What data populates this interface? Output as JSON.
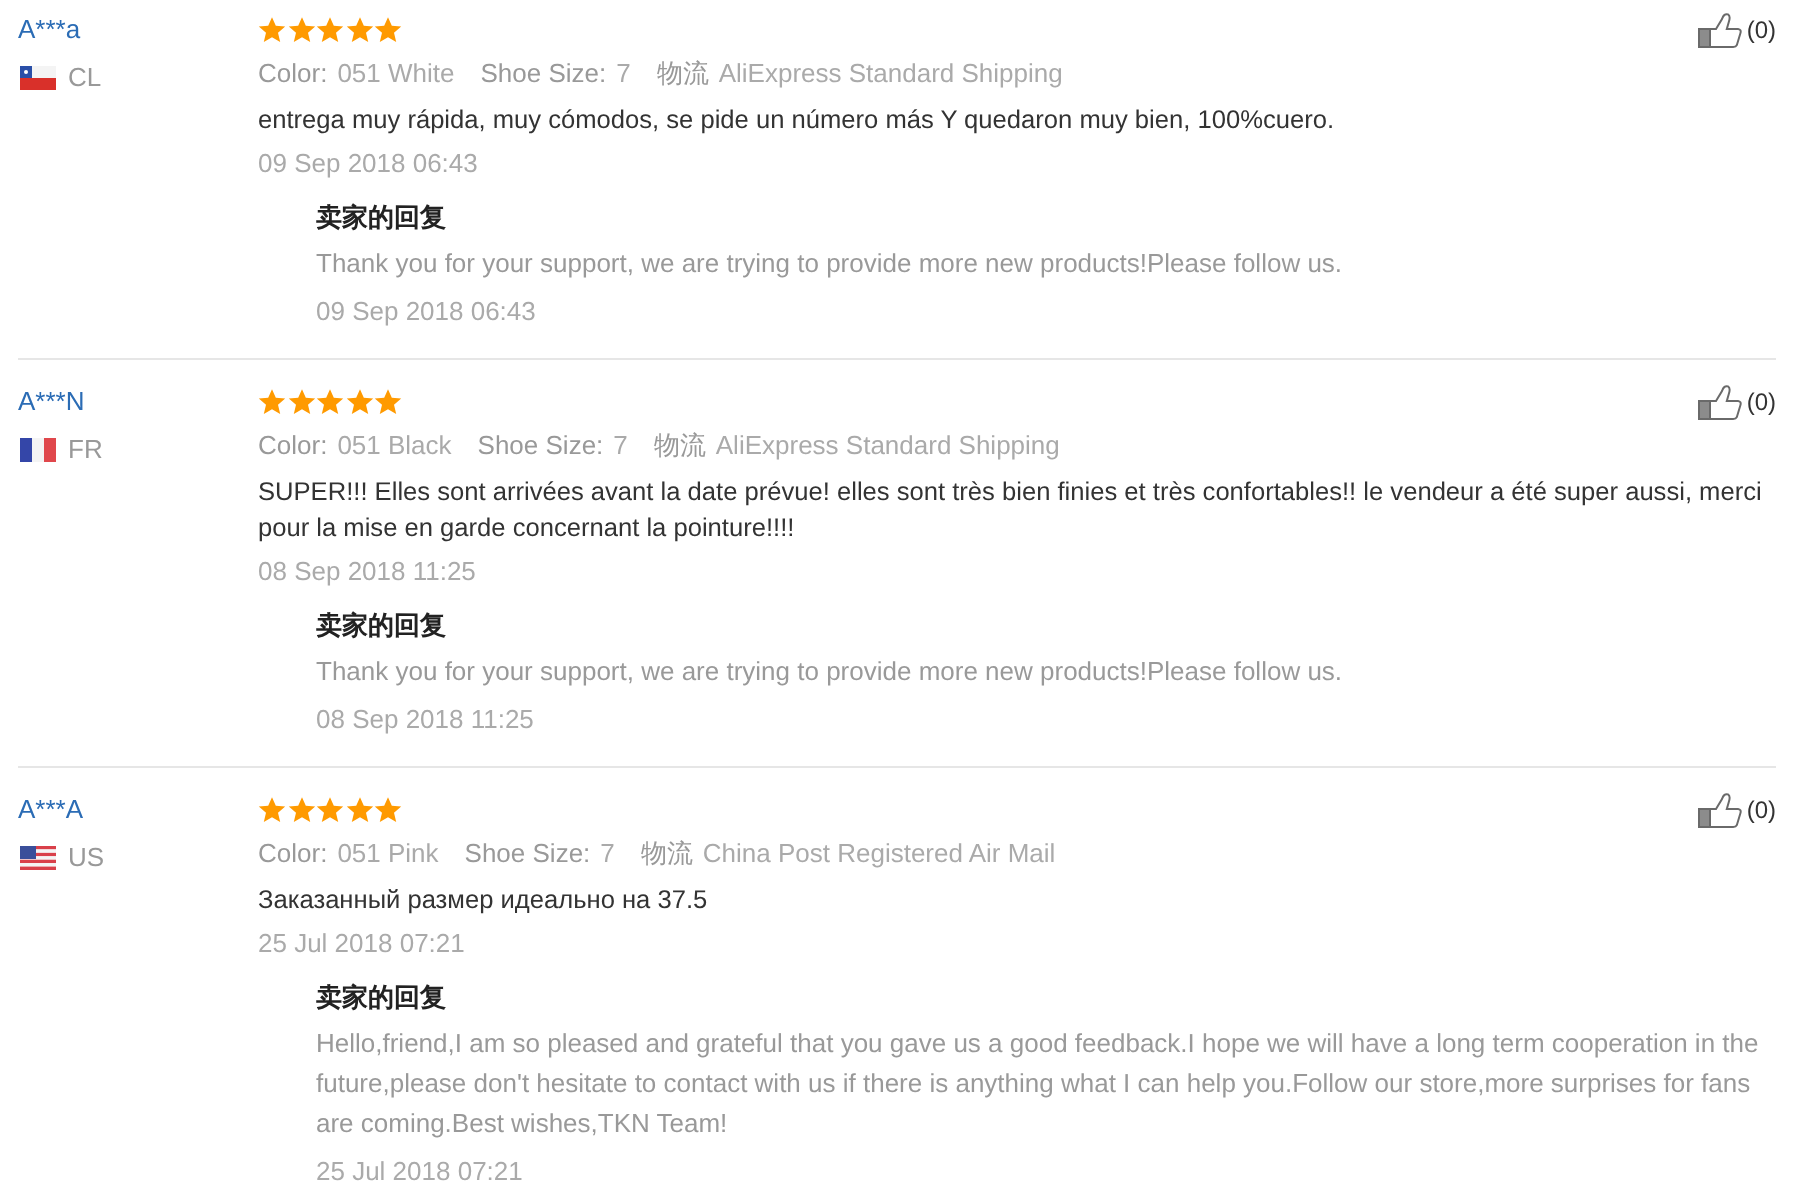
{
  "reviews": [
    {
      "buyer": "A***a",
      "flag": {
        "kind": "chile"
      },
      "country": "CL",
      "stars": 5,
      "helpful": "(0)",
      "attributes": [
        {
          "label": "Color:",
          "value": "051 White"
        },
        {
          "label": "Shoe Size:",
          "value": "7"
        },
        {
          "label": "物流",
          "value": "AliExpress Standard Shipping"
        }
      ],
      "text": "entrega muy rápida, muy cómodos, se pide un número más Y quedaron muy bien, 100%cuero.",
      "date": "09 Sep 2018 06:43",
      "reply": {
        "heading": "卖家的回复",
        "text": "Thank you for your support, we are trying to provide more new products!Please follow us.",
        "date": "09 Sep 2018 06:43"
      }
    },
    {
      "buyer": "A***N",
      "flag": {
        "kind": "france"
      },
      "country": "FR",
      "stars": 5,
      "helpful": "(0)",
      "attributes": [
        {
          "label": "Color:",
          "value": "051 Black"
        },
        {
          "label": "Shoe Size:",
          "value": "7"
        },
        {
          "label": "物流",
          "value": "AliExpress Standard Shipping"
        }
      ],
      "text": "SUPER!!! Elles sont arrivées avant la date prévue! elles sont très bien finies et très confortables!! le vendeur a été super aussi, merci pour la mise en garde concernant la pointure!!!!",
      "date": "08 Sep 2018 11:25",
      "reply": {
        "heading": "卖家的回复",
        "text": "Thank you for your support, we are trying to provide more new products!Please follow us.",
        "date": "08 Sep 2018 11:25"
      }
    },
    {
      "buyer": "A***A",
      "flag": {
        "kind": "usa"
      },
      "country": "US",
      "stars": 5,
      "helpful": "(0)",
      "attributes": [
        {
          "label": "Color:",
          "value": "051 Pink"
        },
        {
          "label": "Shoe Size:",
          "value": "7"
        },
        {
          "label": "物流",
          "value": "China Post Registered Air Mail"
        }
      ],
      "text": "Заказанный размер идеально на 37.5",
      "date": "25 Jul 2018 07:21",
      "reply": {
        "heading": "卖家的回复",
        "text": "Hello,friend,I am so pleased and grateful that you gave us a good feedback.I hope we will have a long term cooperation in the future,please don't hesitate to contact with us if there is anything what I can help you.Follow our store,more surprises for fans are coming.Best wishes,TKN Team!",
        "date": "25 Jul 2018 07:21"
      }
    }
  ]
}
